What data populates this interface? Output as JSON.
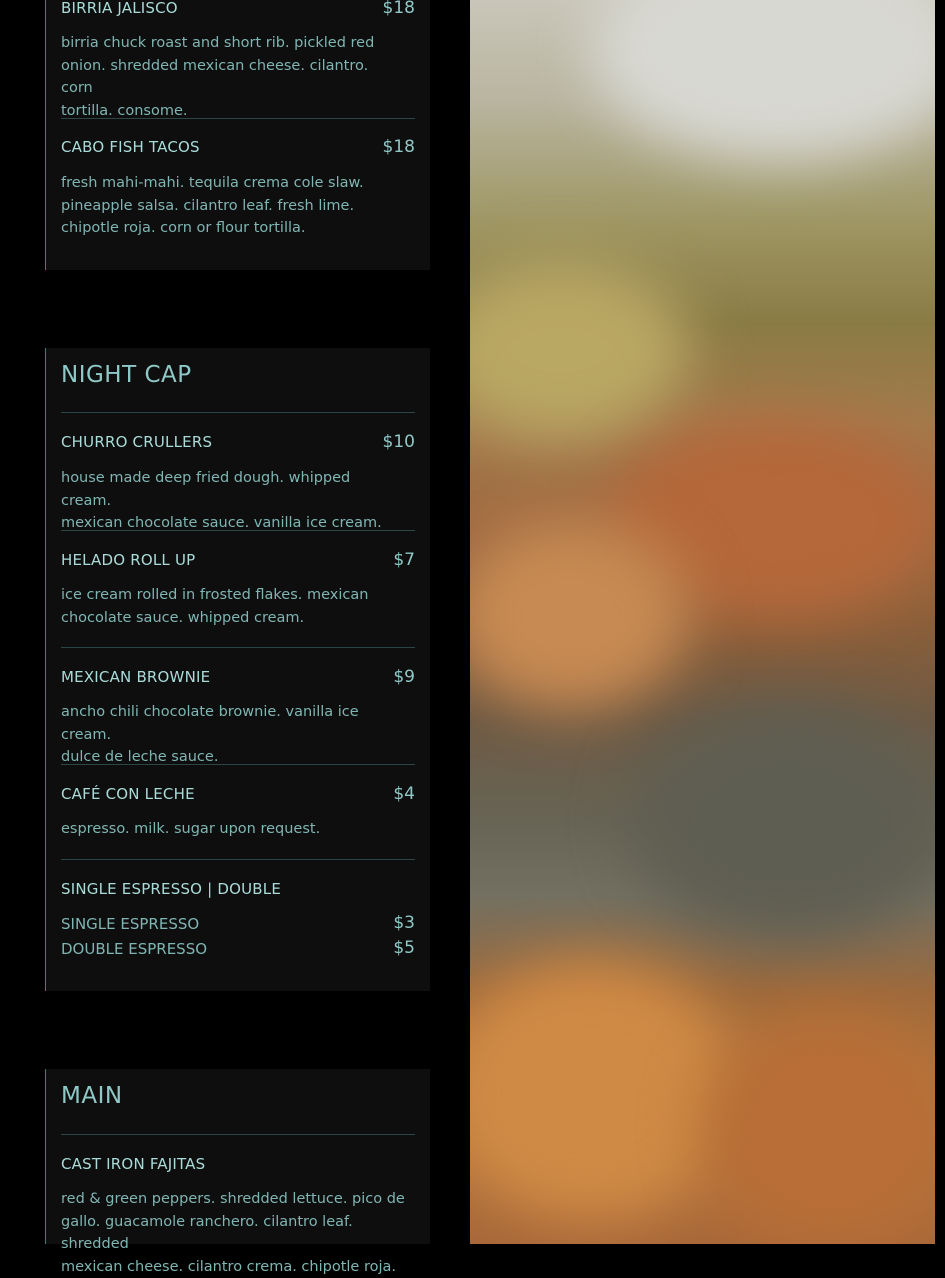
{
  "top_section": {
    "items": [
      {
        "name": "BIRRIA JALISCO",
        "price": "$18",
        "desc_lines": [
          "birria chuck roast and short rib. pickled red",
          "onion. shredded mexican cheese. cilantro. corn",
          "tortilla. consome."
        ]
      },
      {
        "name": "CABO FISH TACOS",
        "price": "$18",
        "desc_lines": [
          "fresh mahi-mahi. tequila crema cole slaw.",
          "pineapple salsa. cilantro leaf. fresh lime.",
          "chipotle roja. corn or flour tortilla."
        ]
      }
    ]
  },
  "night_cap": {
    "title": "NIGHT CAP",
    "items": [
      {
        "name": "CHURRO CRULLERS",
        "price": "$10",
        "desc_lines": [
          "house made deep fried dough. whipped cream.",
          "mexican chocolate sauce. vanilla ice cream."
        ]
      },
      {
        "name": "HELADO ROLL UP",
        "price": "$7",
        "desc_lines": [
          "ice cream rolled in frosted flakes. mexican",
          "chocolate sauce. whipped cream."
        ]
      },
      {
        "name": "MEXICAN BROWNIE",
        "price": "$9",
        "desc_lines": [
          "ancho chili chocolate brownie. vanilla ice cream.",
          "dulce de leche sauce."
        ]
      },
      {
        "name": "CAFÉ CON LECHE",
        "price": "$4",
        "desc_lines": [
          "espresso. milk. sugar upon request."
        ]
      }
    ],
    "espresso": {
      "name": "SINGLE ESPRESSO | DOUBLE",
      "options": [
        {
          "label": "SINGLE ESPRESSO",
          "price": "$3"
        },
        {
          "label": "DOUBLE ESPRESSO",
          "price": "$5"
        }
      ]
    }
  },
  "main": {
    "title": "MAIN",
    "items": [
      {
        "name": "CAST IRON FAJITAS",
        "desc_lines": [
          "red & green peppers. shredded lettuce. pico de",
          "gallo. guacamole ranchero. cilantro leaf. shredded",
          "mexican cheese. cilantro crema. chipotle roja."
        ]
      }
    ]
  },
  "colors": {
    "accent": "#8fc9c7",
    "card_bg": "#0e0e0e",
    "page_bg": "#000000"
  }
}
